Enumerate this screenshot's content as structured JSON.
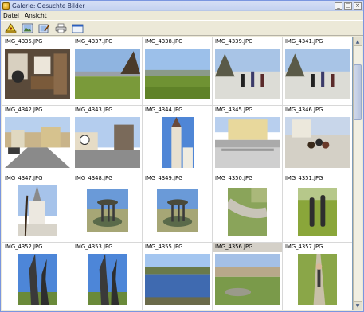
{
  "window": {
    "title": "Galerie: Gesuchte Bilder",
    "controls": [
      "_",
      "□",
      "×"
    ]
  },
  "menu": [
    "Datei",
    "Ansicht"
  ],
  "toolbar": [
    "stamp-icon",
    "image-icon",
    "edit-image-icon",
    "print-icon",
    "window-icon"
  ],
  "gallery": {
    "selected_index": 18,
    "items": [
      {
        "name": "IMG_4335.JPG",
        "scene": "interior"
      },
      {
        "name": "IMG_4337.JPG",
        "scene": "meadow"
      },
      {
        "name": "IMG_4338.JPG",
        "scene": "meadow-wide"
      },
      {
        "name": "IMG_4339.JPG",
        "scene": "people-winter"
      },
      {
        "name": "IMG_4341.JPG",
        "scene": "people-winter"
      },
      {
        "name": "IMG_4342.JPG",
        "scene": "street"
      },
      {
        "name": "IMG_4343.JPG",
        "scene": "street-sign"
      },
      {
        "name": "IMG_4344.JPG",
        "scene": "church-tower"
      },
      {
        "name": "IMG_4345.JPG",
        "scene": "building-stairs"
      },
      {
        "name": "IMG_4346.JPG",
        "scene": "people-sitting"
      },
      {
        "name": "IMG_4347.JPG",
        "scene": "church-tree"
      },
      {
        "name": "IMG_4348.JPG",
        "scene": "fountain"
      },
      {
        "name": "IMG_4349.JPG",
        "scene": "fountain"
      },
      {
        "name": "IMG_4350.JPG",
        "scene": "creek"
      },
      {
        "name": "IMG_4351.JPG",
        "scene": "sculpture-grass"
      },
      {
        "name": "IMG_4352.JPG",
        "scene": "sculpture-sky"
      },
      {
        "name": "IMG_4353.JPG",
        "scene": "sculpture-sky"
      },
      {
        "name": "IMG_4355.JPG",
        "scene": "lake"
      },
      {
        "name": "IMG_4356.JPG",
        "scene": "town-park"
      },
      {
        "name": "IMG_4357.JPG",
        "scene": "path-person"
      }
    ]
  },
  "colors": {
    "sky": "#8fb4e0",
    "grass": "#7a9a3a",
    "snow": "#dcdcd6",
    "border": "#7f9db9"
  }
}
